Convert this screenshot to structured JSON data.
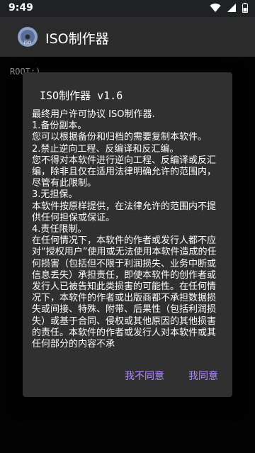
{
  "status": {
    "time": "9:49"
  },
  "app": {
    "title": "ISO制作器"
  },
  "console": {
    "text": "ROOT:)"
  },
  "dialog": {
    "title": "ISO制作器 v1.6",
    "lines": [
      "最终用户许可协议 ISO制作器.",
      "1.备份副本。",
      "您可以根据备份和归档的需要复制本软件。",
      "2.禁止逆向工程、反编译和反汇编。",
      "您不得对本软件进行逆向工程、反编译或反汇编，除非且仅在适用法律明确允许的范围内，尽管有此限制。",
      "3.无担保。",
      "本软件按原样提供，在法律允许的范围内不提供任何担保或保证。",
      "4.责任限制。",
      "在任何情况下，本软件的作者或发行人都不应对“授权用户”使用或无法使用本软件造成的任何损害（包括但不限于利润损失、业务中断或信息丢失）承担责任，即使本软件的创作者或发行人已被告知此类损害的可能性。在任何情况下，本软件的作者或出版商都不承担数据损失或间接、特殊、附带、后果性（包括利润损失）或基于合同、侵权或其他原因的其他损害的责任。本软件的作者或发行人对本软件或其任何部分的内容不承"
    ],
    "decline_label": "我不同意",
    "accept_label": "我同意"
  }
}
